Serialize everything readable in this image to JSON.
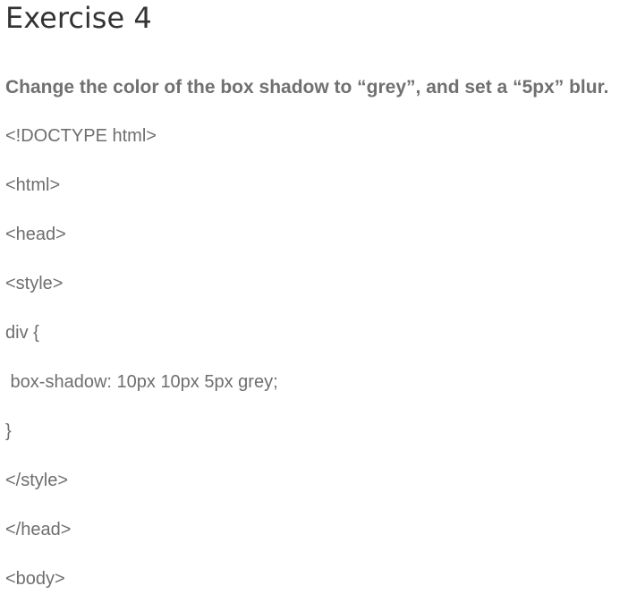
{
  "exercise": {
    "title": "Exercise 4",
    "instruction": "Change the color of the box shadow to “grey”, and set a “5px” blur.",
    "code_lines": [
      "<!DOCTYPE html>",
      "<html>",
      "<head>",
      "<style>",
      "div {",
      " box-shadow: 10px 10px 5px grey;",
      "}",
      "</style>",
      "</head>",
      "<body>"
    ]
  }
}
